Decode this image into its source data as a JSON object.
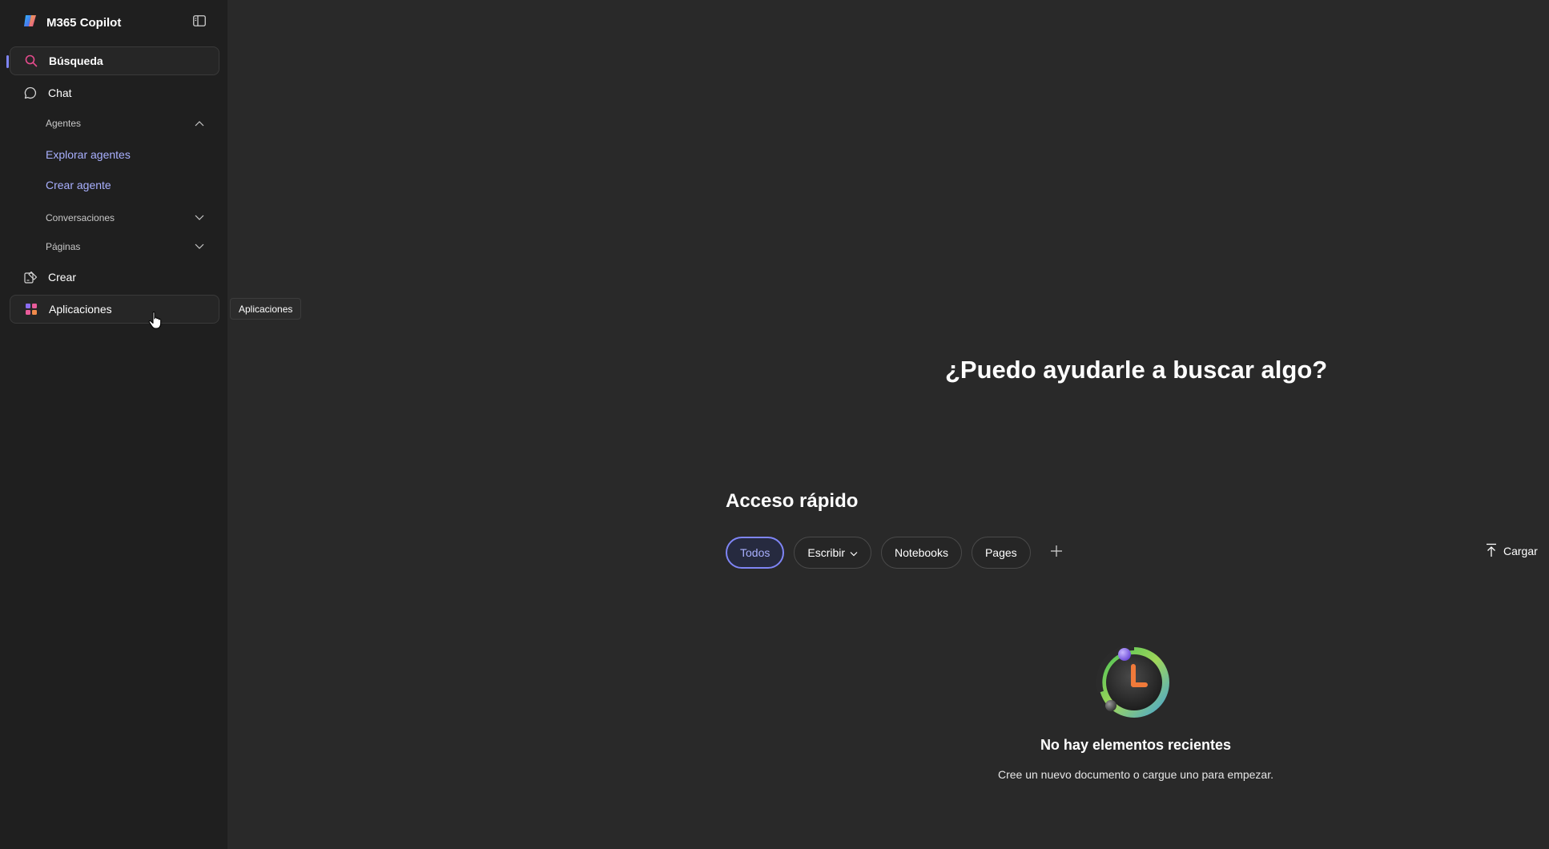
{
  "app": {
    "title": "M365 Copilot"
  },
  "sidebar": {
    "search_label": "Búsqueda",
    "chat_label": "Chat",
    "agents_label": "Agentes",
    "explore_agents_label": "Explorar agentes",
    "create_agent_label": "Crear agente",
    "conversations_label": "Conversaciones",
    "pages_label": "Páginas",
    "create_label": "Crear",
    "apps_label": "Aplicaciones"
  },
  "tooltip": {
    "text": "Aplicaciones"
  },
  "main": {
    "hero_title": "¿Puedo ayudarle a buscar algo?",
    "quick_access_title": "Acceso rápido",
    "filters": [
      "Todos",
      "Escribir",
      "Notebooks",
      "Pages"
    ],
    "selected_filter": "Todos",
    "upload_label": "Cargar",
    "empty_title": "No hay elementos recientes",
    "empty_subtitle": "Cree un nuevo documento o cargue uno para empezar."
  },
  "colors": {
    "accent": "#7f85f5",
    "link": "#a9b0ff",
    "sidebar_bg": "#1f1f1f",
    "main_bg": "#292929"
  },
  "icons": {
    "brand": "copilot-logo-icon",
    "toggle": "sidebar-toggle-icon",
    "search": "search-icon",
    "chat": "chat-bubble-icon",
    "create": "create-icon",
    "apps": "apps-grid-icon",
    "upload": "upload-icon",
    "add": "plus-icon"
  }
}
